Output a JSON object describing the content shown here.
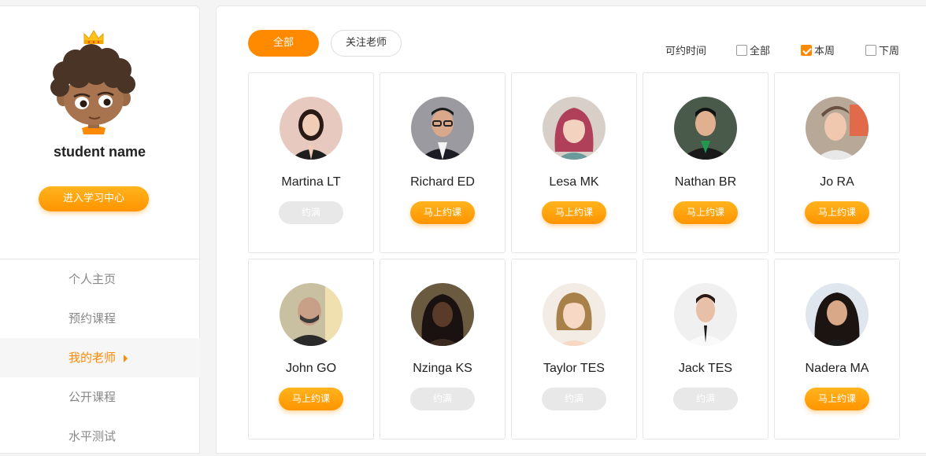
{
  "sidebar": {
    "student_name": "student name",
    "study_center_button": "进入学习中心",
    "nav": [
      {
        "label": "个人主页",
        "active": false
      },
      {
        "label": "预约课程",
        "active": false
      },
      {
        "label": "我的老师",
        "active": true
      },
      {
        "label": "公开课程",
        "active": false
      },
      {
        "label": "水平测试",
        "active": false
      }
    ]
  },
  "filters": {
    "all_label": "全部",
    "follow_label": "关注老师",
    "time_label": "可约时间",
    "time_options": [
      {
        "label": "全部",
        "checked": false
      },
      {
        "label": "本周",
        "checked": true
      },
      {
        "label": "下周",
        "checked": false
      }
    ]
  },
  "teachers": [
    {
      "name": "Martina LT",
      "button": "约满",
      "available": false
    },
    {
      "name": "Richard ED",
      "button": "马上约课",
      "available": true
    },
    {
      "name": "Lesa MK",
      "button": "马上约课",
      "available": true
    },
    {
      "name": "Nathan BR",
      "button": "马上约课",
      "available": true
    },
    {
      "name": "Jo RA",
      "button": "马上约课",
      "available": true
    },
    {
      "name": "John GO",
      "button": "马上约课",
      "available": true
    },
    {
      "name": "Nzinga KS",
      "button": "约满",
      "available": false
    },
    {
      "name": "Taylor TES",
      "button": "约满",
      "available": false
    },
    {
      "name": "Jack TES",
      "button": "约满",
      "available": false
    },
    {
      "name": "Nadera MA",
      "button": "马上约课",
      "available": true
    }
  ]
}
